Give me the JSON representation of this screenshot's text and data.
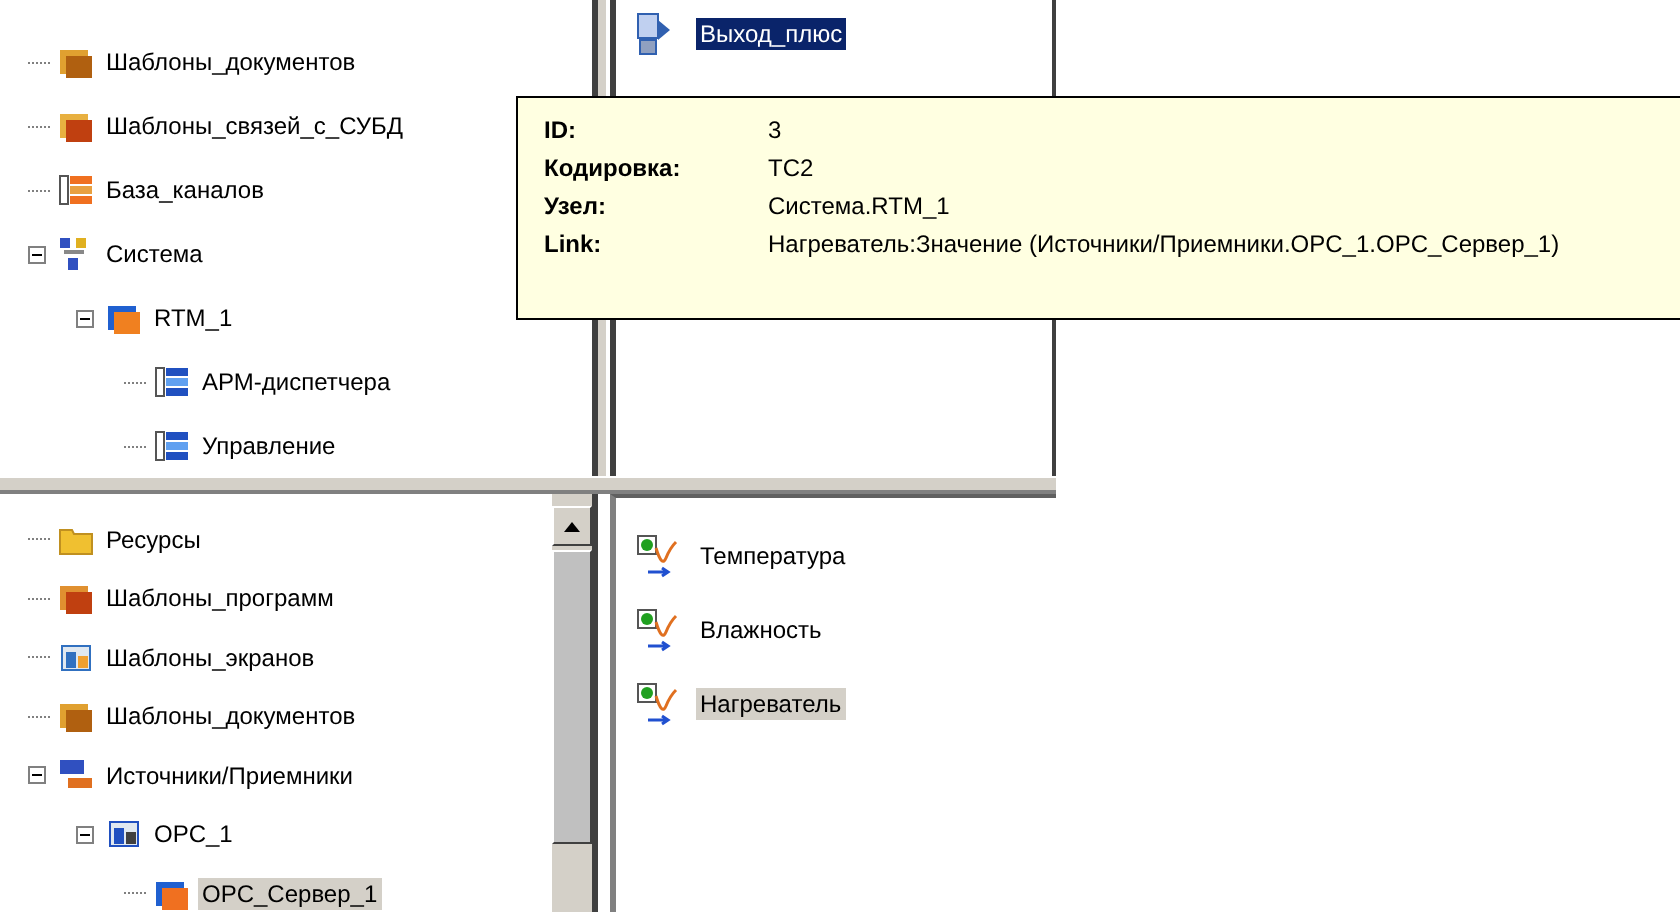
{
  "top_tree": [
    {
      "label": "Шаблоны_документов",
      "kind": "documents"
    },
    {
      "label": "Шаблоны_связей_с_СУБД",
      "kind": "dblinks"
    },
    {
      "label": "База_каналов",
      "kind": "channels"
    },
    {
      "label": "Система",
      "kind": "system",
      "expanded": true,
      "children": [
        {
          "label": "RTM_1",
          "kind": "node",
          "expanded": true,
          "children": [
            {
              "label": "АРМ-диспетчера",
              "kind": "list"
            },
            {
              "label": "Управление",
              "kind": "list"
            }
          ]
        }
      ]
    }
  ],
  "top_list": [
    {
      "label": "Выход_плюс",
      "selected": true
    }
  ],
  "bottom_tree": [
    {
      "label": "Ресурсы",
      "kind": "resources",
      "selected": false
    },
    {
      "label": "Шаблоны_программ",
      "kind": "programs",
      "selected": false
    },
    {
      "label": "Шаблоны_экранов",
      "kind": "screens",
      "selected": false
    },
    {
      "label": "Шаблоны_документов",
      "kind": "documents",
      "selected": false
    },
    {
      "label": "Источники/Приемники",
      "kind": "sources",
      "selected": false,
      "expanded": true,
      "children": [
        {
          "label": "OPC_1",
          "kind": "opc",
          "selected": false,
          "expanded": true,
          "children": [
            {
              "label": "OPC_Сервер_1",
              "kind": "server",
              "selected": true
            }
          ]
        }
      ]
    }
  ],
  "bottom_list": [
    {
      "label": "Температура",
      "kind": "signal",
      "selected": false
    },
    {
      "label": "Влажность",
      "kind": "signal",
      "selected": false
    },
    {
      "label": "Нагреватель",
      "kind": "signal",
      "selected": true
    }
  ],
  "tooltip": [
    {
      "label": "ID:",
      "value": "3"
    },
    {
      "label": "Кодировка:",
      "value": "TC2"
    },
    {
      "label": "Узел:",
      "value": "Система.RTM_1"
    },
    {
      "label": "Link:",
      "value": "Нагреватель:Значение (Источники/Приемники.OPC_1.OPC_Сервер_1)"
    }
  ]
}
